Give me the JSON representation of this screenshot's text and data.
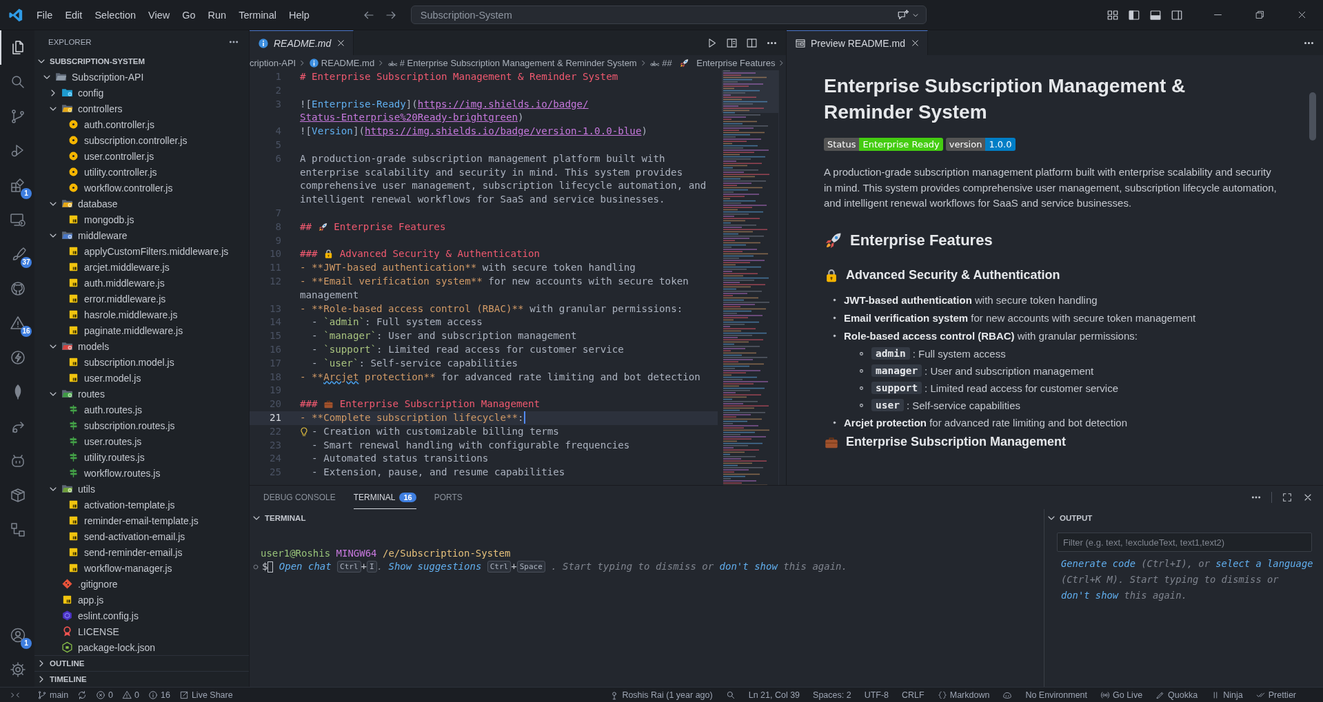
{
  "title_bar": {
    "menu": [
      "File",
      "Edit",
      "Selection",
      "View",
      "Go",
      "Run",
      "Terminal",
      "Help"
    ],
    "search": "Subscription-System"
  },
  "activity_bar": {
    "items": [
      {
        "kind": "files",
        "selected": true
      },
      {
        "kind": "search",
        "selected": false
      },
      {
        "kind": "source-control",
        "selected": false
      },
      {
        "kind": "run-debug",
        "selected": false
      },
      {
        "kind": "extensions",
        "selected": false,
        "badge": "1"
      },
      {
        "kind": "remote",
        "selected": false
      },
      {
        "kind": "brush",
        "selected": false,
        "badge": "37"
      },
      {
        "kind": "github",
        "selected": false
      },
      {
        "kind": "warning",
        "selected": false,
        "badge": "16"
      },
      {
        "kind": "bolt",
        "selected": false
      },
      {
        "kind": "leaf",
        "selected": false
      },
      {
        "kind": "share",
        "selected": false
      },
      {
        "kind": "robot",
        "selected": false
      },
      {
        "kind": "box",
        "selected": false
      },
      {
        "kind": "diagram",
        "selected": false
      }
    ],
    "bottom": [
      {
        "kind": "account",
        "badge": "1"
      },
      {
        "kind": "settings"
      }
    ]
  },
  "sidebar": {
    "title": "EXPLORER",
    "root": {
      "label": "SUBSCRIPTION-SYSTEM",
      "expanded": true
    },
    "tree": [
      {
        "label": "Subscription-API",
        "kind": "folder",
        "expanded": true,
        "children": [
          {
            "label": "config",
            "kind": "folder-config",
            "expanded": false
          },
          {
            "label": "controllers",
            "kind": "folder-controllers",
            "expanded": true,
            "children": [
              {
                "label": "auth.controller.js",
                "kind": "controller"
              },
              {
                "label": "subscription.controller.js",
                "kind": "controller"
              },
              {
                "label": "user.controller.js",
                "kind": "controller"
              },
              {
                "label": "utility.controller.js",
                "kind": "controller"
              },
              {
                "label": "workflow.controller.js",
                "kind": "controller"
              }
            ]
          },
          {
            "label": "database",
            "kind": "folder-database",
            "expanded": true,
            "children": [
              {
                "label": "mongodb.js",
                "kind": "js"
              }
            ]
          },
          {
            "label": "middleware",
            "kind": "folder-middleware",
            "expanded": true,
            "children": [
              {
                "label": "applyCustomFilters.middleware.js",
                "kind": "js"
              },
              {
                "label": "arcjet.middleware.js",
                "kind": "js"
              },
              {
                "label": "auth.middleware.js",
                "kind": "js"
              },
              {
                "label": "error.middleware.js",
                "kind": "js"
              },
              {
                "label": "hasrole.middleware.js",
                "kind": "js"
              },
              {
                "label": "paginate.middleware.js",
                "kind": "js"
              }
            ]
          },
          {
            "label": "models",
            "kind": "folder-models",
            "expanded": true,
            "children": [
              {
                "label": "subscription.model.js",
                "kind": "js"
              },
              {
                "label": "user.model.js",
                "kind": "js"
              }
            ]
          },
          {
            "label": "routes",
            "kind": "folder-routes",
            "expanded": true,
            "children": [
              {
                "label": "auth.routes.js",
                "kind": "route"
              },
              {
                "label": "subscription.routes.js",
                "kind": "route"
              },
              {
                "label": "user.routes.js",
                "kind": "route"
              },
              {
                "label": "utility.routes.js",
                "kind": "route"
              },
              {
                "label": "workflow.routes.js",
                "kind": "route"
              }
            ]
          },
          {
            "label": "utils",
            "kind": "folder-utils",
            "expanded": true,
            "children": [
              {
                "label": "activation-template.js",
                "kind": "js"
              },
              {
                "label": "reminder-email-template.js",
                "kind": "js"
              },
              {
                "label": "send-activation-email.js",
                "kind": "js"
              },
              {
                "label": "send-reminder-email.js",
                "kind": "js"
              },
              {
                "label": "workflow-manager.js",
                "kind": "js"
              }
            ]
          },
          {
            "label": ".gitignore",
            "kind": "git"
          },
          {
            "label": "app.js",
            "kind": "js"
          },
          {
            "label": "eslint.config.js",
            "kind": "eslint"
          },
          {
            "label": "LICENSE",
            "kind": "license"
          },
          {
            "label": "package-lock.json",
            "kind": "node"
          }
        ]
      }
    ],
    "sections": [
      {
        "label": "OUTLINE",
        "expanded": false
      },
      {
        "label": "TIMELINE",
        "expanded": false
      }
    ]
  },
  "editor": {
    "tabs": [
      {
        "label": "README.md",
        "selected": true,
        "preview": true
      }
    ],
    "breadcrumb": [
      {
        "kind": "folder",
        "tokens": [
          {
            "kind": "text",
            "text": "cription-API"
          }
        ]
      },
      {
        "kind": "file",
        "tokens": [
          {
            "kind": "text",
            "text": "README.md"
          }
        ]
      },
      {
        "kind": "symbol",
        "tokens": [
          {
            "kind": "text",
            "text": "# Enterprise Subscription Management & Reminder System"
          }
        ]
      },
      {
        "kind": "symbol",
        "tokens": [
          {
            "kind": "text",
            "text": "##"
          },
          {
            "kind": "rocket"
          },
          {
            "kind": "text",
            "text": "Enterprise Features"
          }
        ]
      }
    ],
    "lines": [
      {
        "number": "1",
        "current": false,
        "lightbulb": false,
        "tokens": [
          {
            "kind": "heading",
            "text": "# Enterprise Subscription Management & Reminder System"
          }
        ]
      },
      {
        "number": "2",
        "current": false,
        "lightbulb": false
      },
      {
        "number": "3",
        "current": false,
        "lightbulb": false,
        "tokens": [
          {
            "kind": "punct",
            "text": "!["
          },
          {
            "kind": "link-text",
            "text": "Enterprise-Ready"
          },
          {
            "kind": "punct",
            "text": "]("
          },
          {
            "kind": "url",
            "text": "https://img.shields.io/badge/Status-Enterprise%20Ready-brightgreen"
          },
          {
            "kind": "punct",
            "text": ")"
          }
        ]
      },
      {
        "number": "4",
        "current": false,
        "lightbulb": false,
        "tokens": [
          {
            "kind": "punct",
            "text": "!["
          },
          {
            "kind": "link-text",
            "text": "Version"
          },
          {
            "kind": "punct",
            "text": "]("
          },
          {
            "kind": "url",
            "text": "https://img.shields.io/badge/version-1.0.0-blue"
          },
          {
            "kind": "punct",
            "text": ")"
          }
        ]
      },
      {
        "number": "5",
        "current": false,
        "lightbulb": false
      },
      {
        "number": "6",
        "current": false,
        "lightbulb": false,
        "tokens": [
          {
            "kind": "text",
            "text": "A production-grade subscription management platform built with enterprise scalability and security in mind. This system provides comprehensive user management, subscription lifecycle automation, and intelligent renewal workflows for SaaS and service businesses."
          }
        ]
      },
      {
        "number": "7",
        "current": false,
        "lightbulb": false
      },
      {
        "number": "8",
        "current": false,
        "lightbulb": false,
        "tokens": [
          {
            "kind": "heading",
            "text": "##"
          },
          {
            "kind": "rocket"
          },
          {
            "kind": "heading",
            "text": "Enterprise Features"
          }
        ]
      },
      {
        "number": "9",
        "current": false,
        "lightbulb": false
      },
      {
        "number": "10",
        "current": false,
        "lightbulb": false,
        "tokens": [
          {
            "kind": "heading",
            "text": "###"
          },
          {
            "kind": "lock"
          },
          {
            "kind": "heading",
            "text": "Advanced Security & Authentication"
          }
        ]
      },
      {
        "number": "11",
        "current": false,
        "lightbulb": false,
        "tokens": [
          {
            "kind": "bold",
            "text": "- **JWT-based authentication**"
          },
          {
            "kind": "text",
            "text": " with secure token handling"
          }
        ]
      },
      {
        "number": "12",
        "current": false,
        "lightbulb": false,
        "tokens": [
          {
            "kind": "bold",
            "text": "- **Email verification system**"
          },
          {
            "kind": "text",
            "text": " for new accounts with secure token management"
          }
        ]
      },
      {
        "number": "13",
        "current": false,
        "lightbulb": false,
        "tokens": [
          {
            "kind": "bold",
            "text": "- **Role-based access control (RBAC)**"
          },
          {
            "kind": "text",
            "text": " with granular permissions:"
          }
        ]
      },
      {
        "number": "14",
        "current": false,
        "lightbulb": false,
        "tokens": [
          {
            "kind": "text",
            "text": "  - "
          },
          {
            "kind": "code",
            "text": "`admin`"
          },
          {
            "kind": "text",
            "text": ": Full system access"
          }
        ]
      },
      {
        "number": "15",
        "current": false,
        "lightbulb": false,
        "tokens": [
          {
            "kind": "text",
            "text": "  - "
          },
          {
            "kind": "code",
            "text": "`manager`"
          },
          {
            "kind": "text",
            "text": ": User and subscription management"
          }
        ]
      },
      {
        "number": "16",
        "current": false,
        "lightbulb": false,
        "tokens": [
          {
            "kind": "text",
            "text": "  - "
          },
          {
            "kind": "code",
            "text": "`support`"
          },
          {
            "kind": "text",
            "text": ": Limited read access for customer service"
          }
        ]
      },
      {
        "number": "17",
        "current": false,
        "lightbulb": false,
        "tokens": [
          {
            "kind": "text",
            "text": "  - "
          },
          {
            "kind": "code",
            "text": "`user`"
          },
          {
            "kind": "text",
            "text": ": Self-service capabilities"
          }
        ]
      },
      {
        "number": "18",
        "current": false,
        "lightbulb": false,
        "tokens": [
          {
            "kind": "bold",
            "text": "- **"
          },
          {
            "kind": "misspelled",
            "text": "Arcjet"
          },
          {
            "kind": "bold",
            "text": " protection**"
          },
          {
            "kind": "text",
            "text": " for advanced rate limiting and bot detection"
          }
        ]
      },
      {
        "number": "19",
        "current": false,
        "lightbulb": false
      },
      {
        "number": "20",
        "current": false,
        "lightbulb": false,
        "tokens": [
          {
            "kind": "heading",
            "text": "###"
          },
          {
            "kind": "briefcase"
          },
          {
            "kind": "heading",
            "text": "Enterprise Subscription Management"
          }
        ]
      },
      {
        "number": "21",
        "current": true,
        "lightbulb": false,
        "tokens": [
          {
            "kind": "bold",
            "text": "- **Complete subscription lifecycle**"
          },
          {
            "kind": "text",
            "text": ":"
          }
        ]
      },
      {
        "number": "22",
        "current": false,
        "lightbulb": true,
        "tokens": [
          {
            "kind": "text",
            "text": "  - Creation with customizable billing terms"
          }
        ]
      },
      {
        "number": "23",
        "current": false,
        "lightbulb": false,
        "tokens": [
          {
            "kind": "text",
            "text": "  - Smart renewal handling with configurable frequencies"
          }
        ]
      },
      {
        "number": "24",
        "current": false,
        "lightbulb": false,
        "tokens": [
          {
            "kind": "text",
            "text": "  - Automated status transitions"
          }
        ]
      },
      {
        "number": "25",
        "current": false,
        "lightbulb": false,
        "tokens": [
          {
            "kind": "text",
            "text": "  - Extension, pause, and resume capabilities"
          }
        ]
      }
    ]
  },
  "preview": {
    "tabs": [
      {
        "label": "Preview README.md",
        "selected": true
      }
    ],
    "blocks": [
      {
        "kind": "h1",
        "tokens": [
          {
            "kind": "text",
            "text": "Enterprise Subscription Management & Reminder System"
          }
        ]
      },
      {
        "kind": "badges",
        "items": [
          {
            "label": "Status",
            "value": "Enterprise Ready",
            "color": "#44cc11"
          },
          {
            "label": "version",
            "value": "1.0.0",
            "color": "#007ec6"
          }
        ]
      },
      {
        "kind": "p",
        "text": "A production-grade subscription management platform built with enterprise scalability and security in mind. This system provides comprehensive user management, subscription lifecycle automation, and intelligent renewal workflows for SaaS and service businesses."
      },
      {
        "kind": "h2",
        "tokens": [
          {
            "kind": "rocket"
          },
          {
            "kind": "text",
            "text": "Enterprise Features"
          }
        ]
      },
      {
        "kind": "h3",
        "tokens": [
          {
            "kind": "lock"
          },
          {
            "kind": "text",
            "text": "Advanced Security & Authentication"
          }
        ]
      },
      {
        "kind": "list",
        "items": [
          {
            "text": "**JWT-based authentication** with secure token handling"
          },
          {
            "text": "**Email verification system** for new accounts with secure token management"
          },
          {
            "text": "**Role-based access control (RBAC)** with granular permissions:",
            "children": [
              {
                "code": "admin",
                "text": ": Full system access"
              },
              {
                "code": "manager",
                "text": ": User and subscription management"
              },
              {
                "code": "support",
                "text": ": Limited read access for customer service"
              },
              {
                "code": "user",
                "text": ": Self-service capabilities"
              }
            ]
          },
          {
            "text": "**Arcjet protection** for advanced rate limiting and bot detection"
          }
        ]
      },
      {
        "kind": "h3",
        "tokens": [
          {
            "kind": "briefcase"
          },
          {
            "kind": "text",
            "text": "Enterprise Subscription Management"
          }
        ]
      }
    ]
  },
  "panel": {
    "tabs": [
      {
        "label": "DEBUG CONSOLE",
        "selected": false
      },
      {
        "label": "TERMINAL",
        "selected": true,
        "badge": "16"
      },
      {
        "label": "PORTS",
        "selected": false
      }
    ],
    "terminal": {
      "title": "TERMINAL",
      "prompt": [
        {
          "kind": "user",
          "text": "user1@Roshis"
        },
        {
          "kind": "shell",
          "text": "MINGW64"
        },
        {
          "kind": "path",
          "text": "/e/Subscription-System"
        }
      ],
      "input_line": [
        {
          "kind": "plain",
          "text": "$"
        },
        {
          "kind": "cursor"
        },
        {
          "kind": "link",
          "text": "Open chat"
        },
        {
          "kind": "key",
          "text": "Ctrl"
        },
        {
          "kind": "plain",
          "text": "+"
        },
        {
          "kind": "key",
          "text": "I"
        },
        {
          "kind": "hint",
          "text": "."
        },
        {
          "kind": "link",
          "text": "Show suggestions"
        },
        {
          "kind": "key",
          "text": "Ctrl"
        },
        {
          "kind": "plain",
          "text": "+"
        },
        {
          "kind": "key",
          "text": "Space"
        },
        {
          "kind": "hint",
          "text": ". Start typing to dismiss or"
        },
        {
          "kind": "link",
          "text": "don't show"
        },
        {
          "kind": "hint",
          "text": "this again."
        }
      ]
    },
    "output": {
      "title": "OUTPUT",
      "filter": {
        "placeholder": "Filter (e.g. text, !excludeText, text1,text2)"
      },
      "hint": [
        {
          "kind": "link",
          "text": "Generate code"
        },
        {
          "kind": "hint",
          "text": " (Ctrl+I), or "
        },
        {
          "kind": "link",
          "text": "select a language"
        },
        {
          "kind": "hint",
          "text": " (Ctrl+K M). Start typing to dismiss or "
        },
        {
          "kind": "link",
          "text": "don't show"
        },
        {
          "kind": "hint",
          "text": " this again."
        }
      ]
    }
  },
  "status_bar": {
    "left": [
      {
        "kind": "remote"
      },
      {
        "kind": "branch",
        "text": "main"
      },
      {
        "kind": "sync"
      },
      {
        "kind": "errors",
        "text": "0"
      },
      {
        "kind": "warnings",
        "text": "0"
      },
      {
        "kind": "infos",
        "text": "16"
      },
      {
        "kind": "live-share",
        "text": "Live Share"
      }
    ],
    "right": [
      {
        "kind": "blame",
        "text": "Roshis Rai (1 year ago)"
      },
      {
        "kind": "zoom"
      },
      {
        "kind": "plain",
        "text": "Ln 21, Col 39"
      },
      {
        "kind": "plain",
        "text": "Spaces: 2"
      },
      {
        "kind": "plain",
        "text": "UTF-8"
      },
      {
        "kind": "plain",
        "text": "CRLF"
      },
      {
        "kind": "language",
        "text": "Markdown"
      },
      {
        "kind": "copilot"
      },
      {
        "kind": "plain",
        "text": "No Environment"
      },
      {
        "kind": "golive",
        "text": "Go Live"
      },
      {
        "kind": "quokka",
        "text": "Quokka"
      },
      {
        "kind": "ninja",
        "text": "Ninja"
      },
      {
        "kind": "prettier",
        "text": "Prettier"
      }
    ]
  }
}
